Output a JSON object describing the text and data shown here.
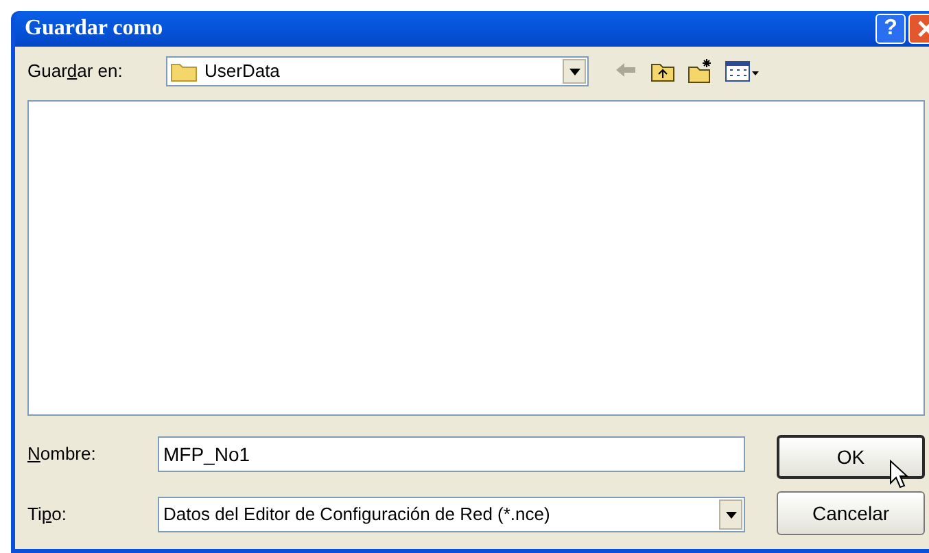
{
  "window": {
    "title": "Guardar como",
    "help_button": "?"
  },
  "save_in": {
    "label": {
      "before": "Guar",
      "key": "d",
      "after": "ar en:"
    },
    "value": "UserData"
  },
  "toolbar": [
    {
      "kind": "back",
      "disabled": true
    },
    {
      "kind": "up",
      "disabled": false
    },
    {
      "kind": "new_folder",
      "disabled": false
    },
    {
      "kind": "view_menu",
      "disabled": false
    }
  ],
  "file_name": {
    "label": {
      "key": "N",
      "after": "ombre:"
    },
    "value": "MFP_No1"
  },
  "file_type": {
    "label": {
      "before": "Ti",
      "key": "p",
      "after": "o:"
    },
    "value": "Datos del Editor de Configuración de Red (*.nce)"
  },
  "buttons": [
    {
      "label": "OK",
      "kind": "default"
    },
    {
      "label": "Cancelar",
      "kind": "normal"
    }
  ]
}
